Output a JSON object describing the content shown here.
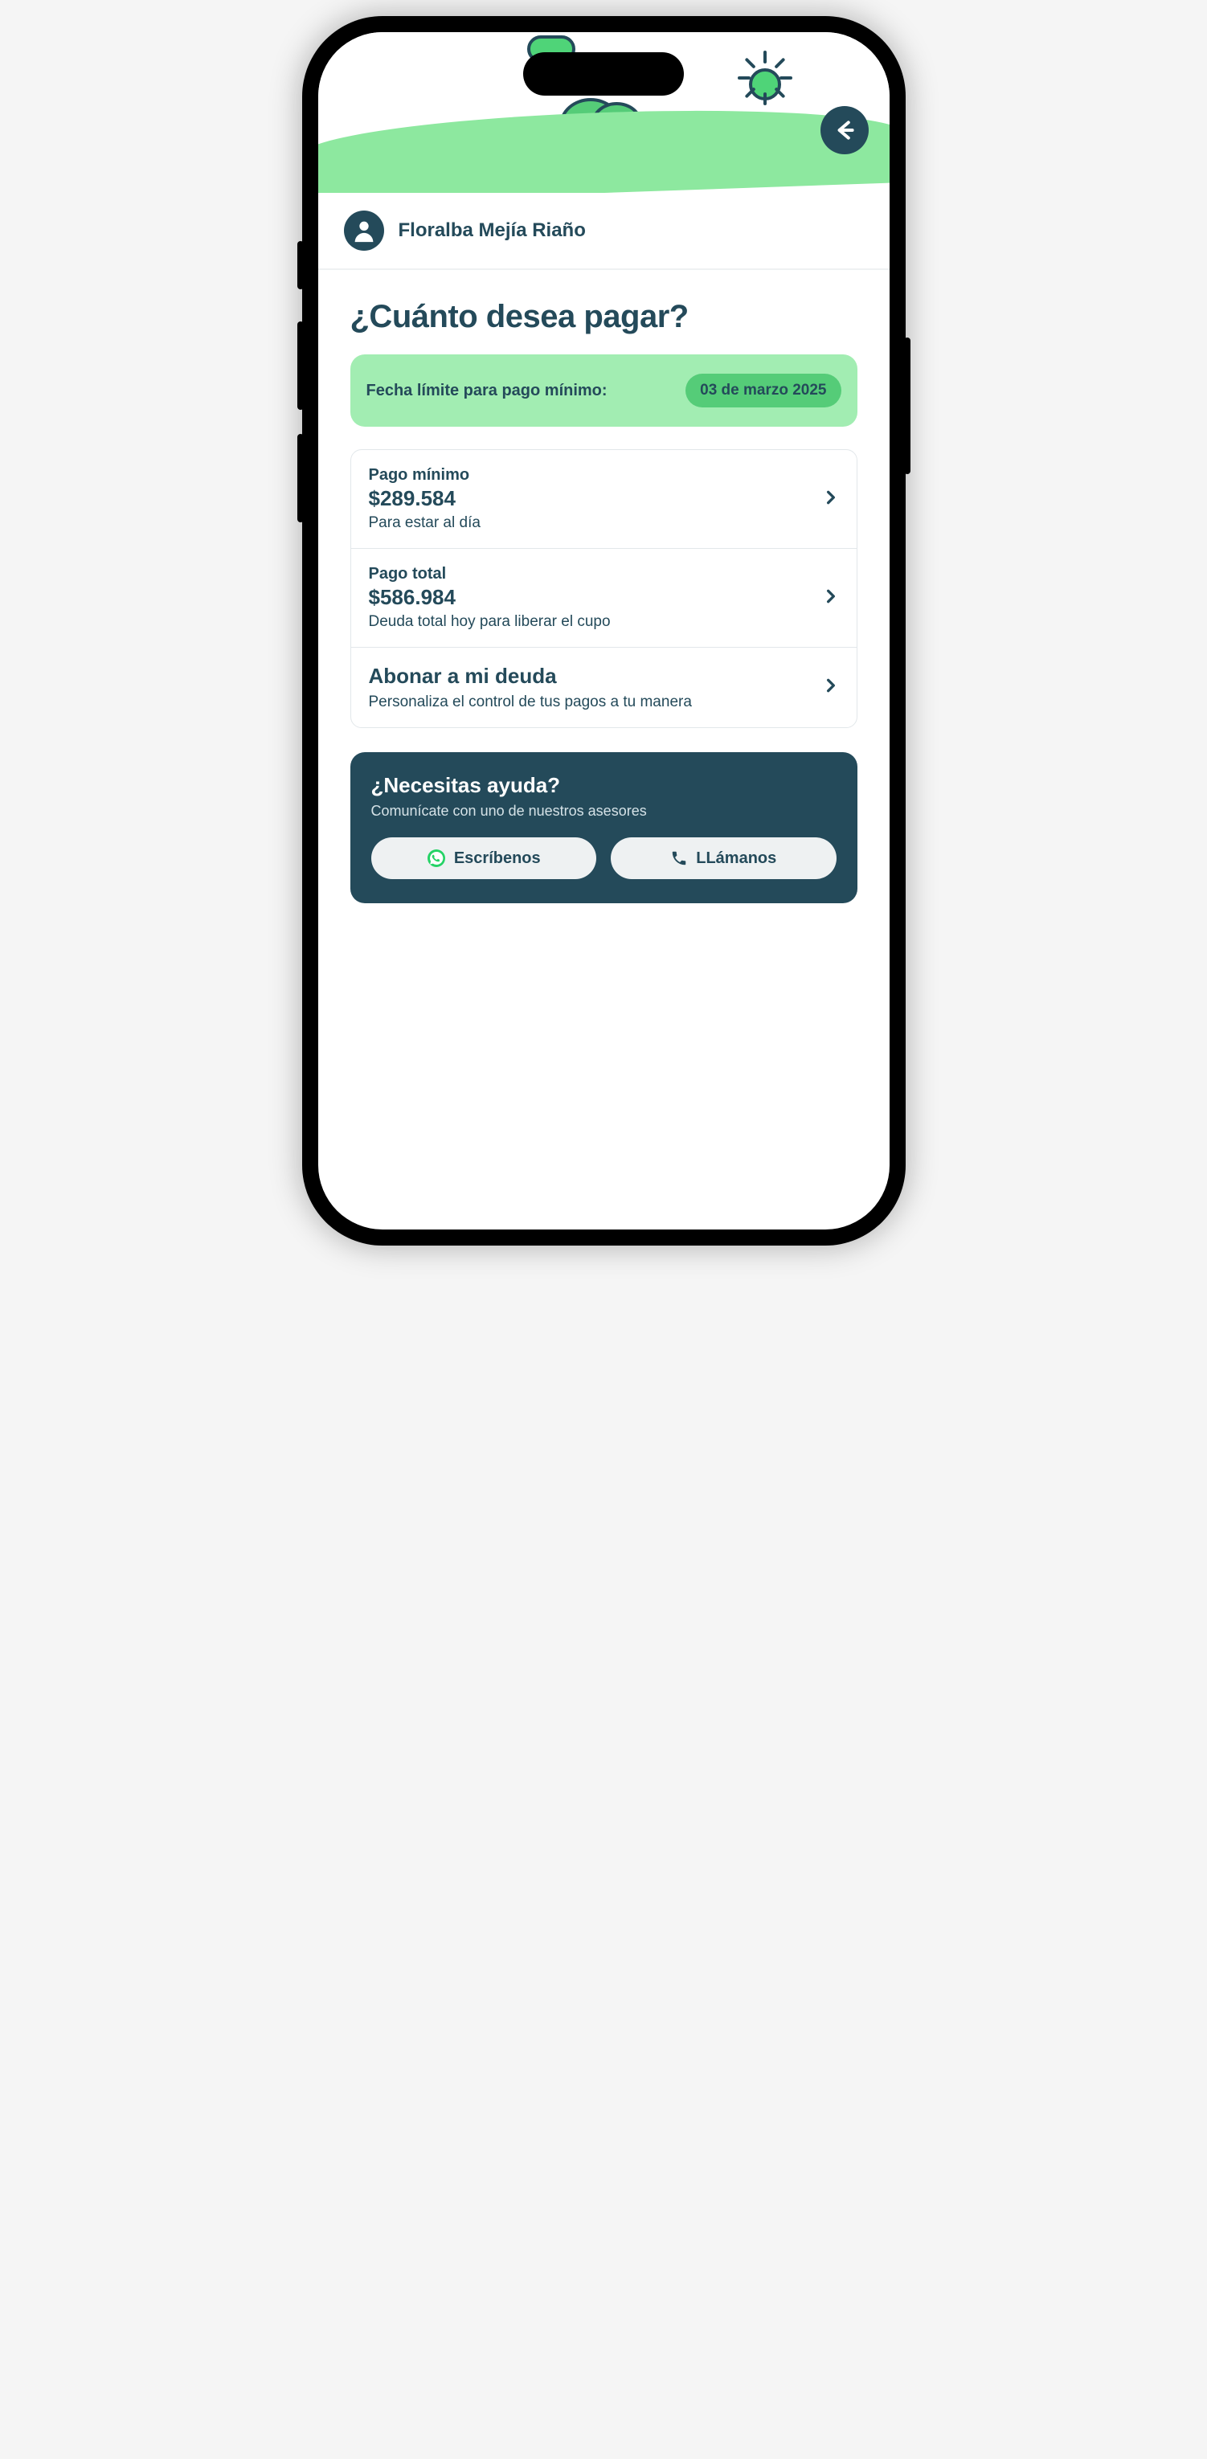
{
  "user": {
    "name": "Floralba Mejía Riaño"
  },
  "page": {
    "title": "¿Cuánto desea pagar?"
  },
  "deadline": {
    "label": "Fecha límite para pago mínimo:",
    "date": "03 de marzo 2025"
  },
  "options": [
    {
      "label": "Pago mínimo",
      "value": "$289.584",
      "hint": "Para estar al día"
    },
    {
      "label": "Pago total",
      "value": "$586.984",
      "hint": "Deuda total hoy para liberar el cupo"
    },
    {
      "title": "Abonar a mi deuda",
      "hint": "Personaliza el control de tus pagos a tu manera"
    }
  ],
  "help": {
    "title": "¿Necesitas ayuda?",
    "subtitle": "Comunícate con uno de nuestros asesores",
    "write_label": "Escríbenos",
    "call_label": "LLámanos"
  }
}
